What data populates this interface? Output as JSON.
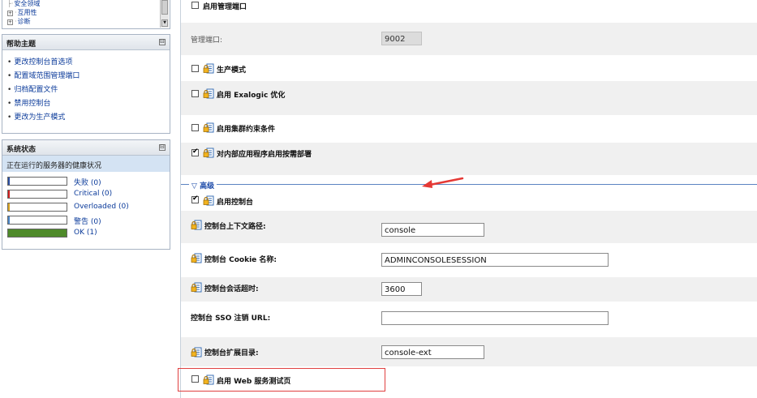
{
  "tree": {
    "items": [
      {
        "label": "安全领域",
        "expander": ""
      },
      {
        "label": "互用性",
        "expander": "+"
      },
      {
        "label": "诊断",
        "expander": "+"
      }
    ]
  },
  "help": {
    "title": "帮助主题",
    "minimize": "⊟",
    "items": [
      "更改控制台首选项",
      "配置域范围管理端口",
      "归档配置文件",
      "禁用控制台",
      "更改为生产模式"
    ]
  },
  "system_status": {
    "title": "系统状态",
    "minimize": "⊟",
    "subtitle": "正在运行的服务器的健康状况",
    "rows": [
      {
        "label": "失败 (0)",
        "color": "#2b4fa3",
        "fill": 0
      },
      {
        "label": "Critical (0)",
        "color": "#d02020",
        "fill": 0
      },
      {
        "label": "Overloaded (0)",
        "color": "#d9a521",
        "fill": 0
      },
      {
        "label": "警告 (0)",
        "color": "#4a86c8",
        "fill": 0
      },
      {
        "label": "OK (1)",
        "color": "#4e8a2a",
        "fill": 1
      }
    ]
  },
  "settings": {
    "admin_port_enabled": {
      "label": "启用管理端口",
      "checked": false
    },
    "admin_port": {
      "label": "管理端口:",
      "value": "9002"
    },
    "production_mode": {
      "label": "生产模式",
      "checked": false
    },
    "exalogic": {
      "label": "启用 Exalogic 优化",
      "checked": false
    },
    "cluster_constraints": {
      "label": "启用集群约束条件",
      "checked": false
    },
    "on_demand_deploy": {
      "label": "对内部应用程序启用按需部署",
      "checked": true
    },
    "advanced": {
      "label": "高级"
    },
    "console_enabled": {
      "label": "启用控制台",
      "checked": true
    },
    "context_path": {
      "label": "控制台上下文路径:",
      "value": "console"
    },
    "cookie_name": {
      "label": "控制台 Cookie 名称:",
      "value": "ADMINCONSOLESESSION"
    },
    "session_timeout": {
      "label": "控制台会话超时:",
      "value": "3600"
    },
    "sso_logout": {
      "label": "控制台 SSO 注销 URL:",
      "value": ""
    },
    "ext_dir": {
      "label": "控制台扩展目录:",
      "value": "console-ext"
    },
    "web_service_test": {
      "label": "启用 Web 服务测试页",
      "checked": false
    }
  },
  "colors": {
    "highlight": "#e04040",
    "arrow": "#e53935",
    "link": "#0a3a9a"
  }
}
